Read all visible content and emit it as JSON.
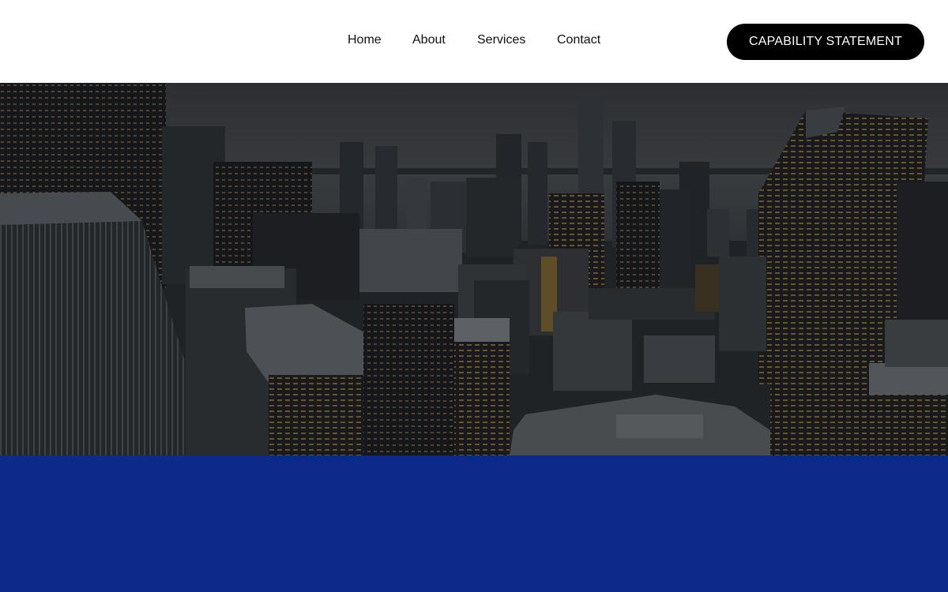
{
  "nav": {
    "items": [
      {
        "label": "Home"
      },
      {
        "label": "About"
      },
      {
        "label": "Services"
      },
      {
        "label": "Contact"
      }
    ],
    "cta_label": "CAPABILITY STATEMENT"
  },
  "colors": {
    "header_bg": "#ffffff",
    "cta_bg": "#000000",
    "cta_text": "#ffffff",
    "band_bg": "#0b2a8a",
    "hero_overlay": "#2b2e33"
  },
  "hero": {
    "image_subject": "city-skyline-aerial-photo"
  }
}
